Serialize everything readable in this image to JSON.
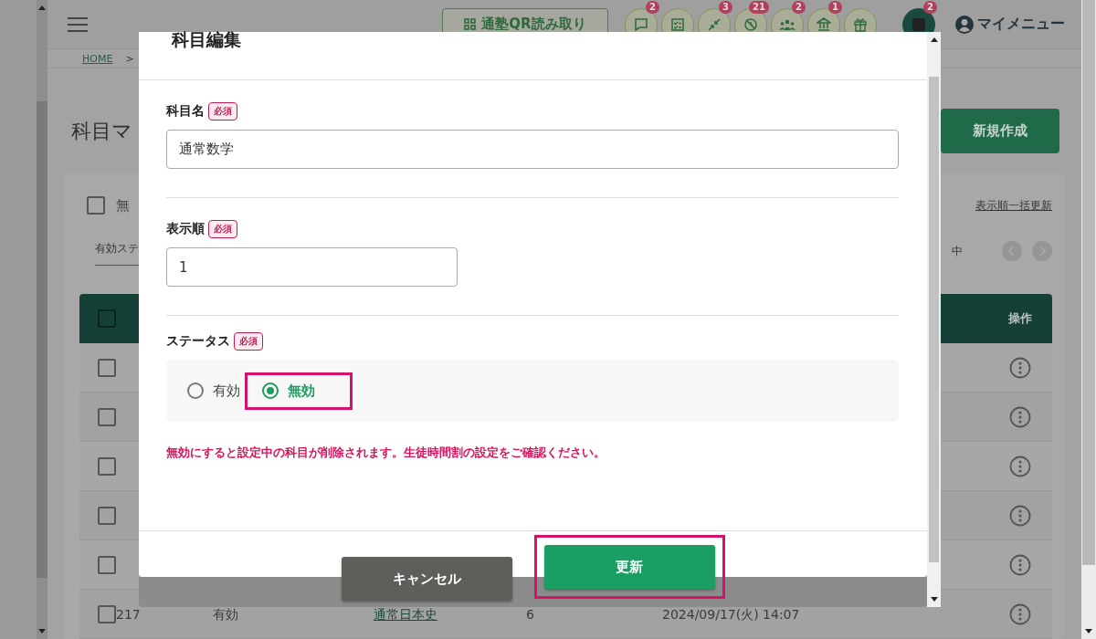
{
  "header": {
    "qr_button": "通塾QR読み取り",
    "icon_buttons": [
      {
        "kind": "chat",
        "badge": "2",
        "active": false
      },
      {
        "kind": "checklist",
        "active": false
      },
      {
        "kind": "transfer",
        "badge": "3",
        "active": false
      },
      {
        "kind": "no-clock",
        "badge": "21",
        "active": false
      },
      {
        "kind": "people",
        "badge": "2",
        "active": false
      },
      {
        "kind": "bank",
        "badge": "1",
        "active": false
      },
      {
        "kind": "gift",
        "active": false
      },
      {
        "kind": "square",
        "badge": "2",
        "active": true
      }
    ],
    "my_menu": "マイメニュー"
  },
  "breadcrumb": {
    "home": "HOME",
    "separator": ">"
  },
  "page": {
    "title": "科目マ",
    "new_button": "新規作成",
    "filter_checkbox": {
      "label": "無",
      "checked": false
    },
    "filter_select": "有効ステ",
    "bulk_link": "表示順一括更新",
    "count_text": "中",
    "table": {
      "header_checked": false,
      "action_header": "操作",
      "rows": [
        {
          "checked": false
        },
        {
          "checked": false
        },
        {
          "checked": false
        },
        {
          "checked": false
        },
        {
          "checked": false
        },
        {
          "checked": false,
          "cells": [
            "217",
            "有効",
            "通常日本史",
            "6",
            "2024/09/17(火) 14:07"
          ]
        }
      ]
    }
  },
  "dialog": {
    "title": "科目編集",
    "fields": [
      {
        "kind": "text",
        "label": "科目名",
        "required": "必須",
        "value": "通常数学"
      },
      {
        "kind": "number",
        "label": "表示順",
        "required": "必須",
        "value": "1"
      },
      {
        "kind": "radio",
        "label": "ステータス",
        "required": "必須",
        "options": [
          {
            "label": "有効",
            "selected": false,
            "highlighted": false
          },
          {
            "label": "無効",
            "selected": true,
            "highlighted": true
          }
        ]
      }
    ],
    "warning": "無効にすると設定中の科目が削除されます。生徒時間割の設定をご確認ください。",
    "buttons": [
      {
        "label": "キャンセル",
        "kind": "secondary",
        "highlighted": false
      },
      {
        "label": "更新",
        "kind": "primary",
        "highlighted": true
      }
    ]
  }
}
